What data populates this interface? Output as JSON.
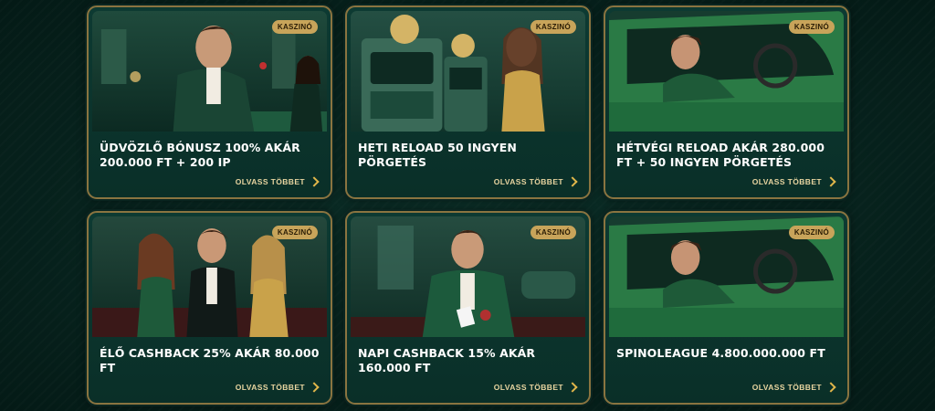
{
  "cards": [
    {
      "badge": "KASZINÓ",
      "title": "ÜDVÖZLŐ BÓNUSZ 100% AKÁR 200.000 FT + 200 IP",
      "link": "OLVASS TÖBBET",
      "image_icon": "casino-man-image"
    },
    {
      "badge": "KASZINÓ",
      "title": "HETI RELOAD 50 INGYEN PÖRGETÉS",
      "link": "OLVASS TÖBBET",
      "image_icon": "slot-machine-image"
    },
    {
      "badge": "KASZINÓ",
      "title": "HÉTVÉGI RELOAD AKÁR 280.000 FT + 50 INGYEN PÖRGETÉS",
      "link": "OLVASS TÖBBET",
      "image_icon": "car-driver-image"
    },
    {
      "badge": "KASZINÓ",
      "title": "ÉLŐ CASHBACK 25% AKÁR 80.000 FT",
      "link": "OLVASS TÖBBET",
      "image_icon": "trio-image"
    },
    {
      "badge": "KASZINÓ",
      "title": "NAPI CASHBACK 15% AKÁR 160.000 FT",
      "link": "OLVASS TÖBBET",
      "image_icon": "card-player-image"
    },
    {
      "badge": "KASZINÓ",
      "title": "SPINOLEAGUE 4.800.000.000 FT",
      "link": "OLVASS TÖBBET",
      "image_icon": "car-driver-image"
    }
  ],
  "colors": {
    "background": "#06211c",
    "card": "#0d3a32",
    "border": "#8a7440",
    "badge": "#c8a45a",
    "link": "#e8d5a0",
    "chevron": "#e0b64a"
  }
}
